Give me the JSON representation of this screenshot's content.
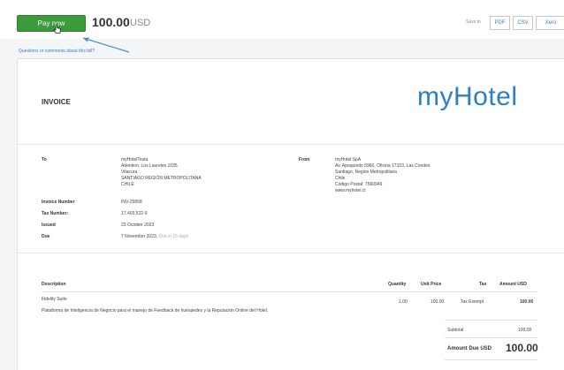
{
  "header": {
    "pay_label": "Pay now",
    "amount": "100.00",
    "currency": "USD",
    "save_to_label": "Save to",
    "export_buttons": [
      "PDF",
      "CSV",
      "Xero"
    ]
  },
  "questions_link": "Questions or comments about this bill?",
  "invoice": {
    "title": "INVOICE",
    "logo_text": "myHotel",
    "to_label": "To",
    "to_lines": [
      "myHotelTesta",
      "Attention: Los Laureles 1035",
      "Vitacura",
      "SANTIAGO REGIÓN METROPOLITANA",
      "CHILE"
    ],
    "from_label": "From",
    "from_lines": [
      "myHotel SpA",
      "Av. Apoquindo 5960, Oficina 17103, Las Condes",
      "Santiago, Región Metropolitana",
      "Chile",
      "Código Postal: 7560949",
      "www.myhotel.cl"
    ],
    "details": [
      {
        "label": "Invoice Number",
        "value": "INV-25858"
      },
      {
        "label": "Tax Number:",
        "value": "17.403.522-9"
      },
      {
        "label": "Issued",
        "value": "23 October 2023"
      },
      {
        "label": "Due",
        "value": "7 November 2023,"
      }
    ],
    "due_note": "Due in 15 days"
  },
  "table": {
    "headers": {
      "description": "Description",
      "quantity": "Quantity",
      "unit_price": "Unit Price",
      "tax": "Tax",
      "amount": "Amount USD"
    },
    "item": {
      "name": "Fidelity Suite",
      "description": "Plataforma de Inteligencia de Negocio para el manejo de Feedback de huéspedes y la Reputación Online del Hotel.",
      "quantity": "1.00",
      "unit_price": "100.00",
      "tax": "Tax Exempt",
      "amount": "100.00"
    },
    "subtotal_label": "Subtotal",
    "subtotal_value": "100.00",
    "amount_due_label": "Amount Due USD",
    "amount_due_value": "100.00"
  },
  "colors": {
    "pay_green": "#3b9a3a",
    "brand_blue": "#2b7fc4",
    "link_blue": "#3a7bc8"
  }
}
